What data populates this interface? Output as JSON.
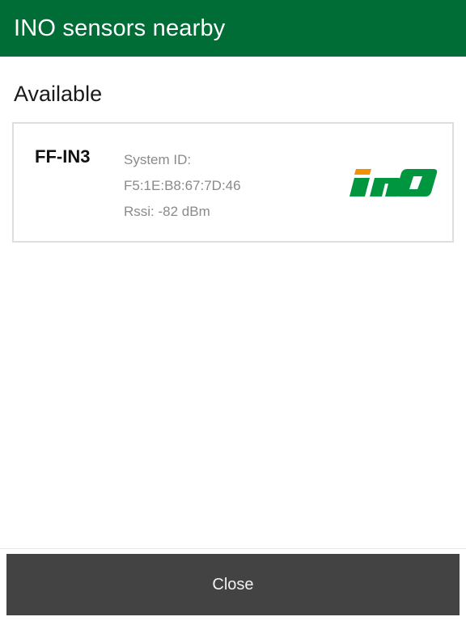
{
  "header": {
    "title": "INO sensors nearby"
  },
  "available": {
    "heading": "Available",
    "sensors": [
      {
        "name": "FF-IN3",
        "system_id_label": "System ID:",
        "system_id": "F5:1E:B8:67:7D:46",
        "rssi": "Rssi: -82 dBm",
        "logo": {
          "icon": "ino-logo",
          "text": "INO",
          "colors": {
            "accent": "#f39200",
            "primary": "#009640"
          }
        }
      }
    ]
  },
  "footer": {
    "close_label": "Close"
  },
  "colors": {
    "header_bg": "#006d36",
    "button_bg": "#434343",
    "card_border": "#dedede",
    "secondary_text": "#8a8a8a"
  }
}
